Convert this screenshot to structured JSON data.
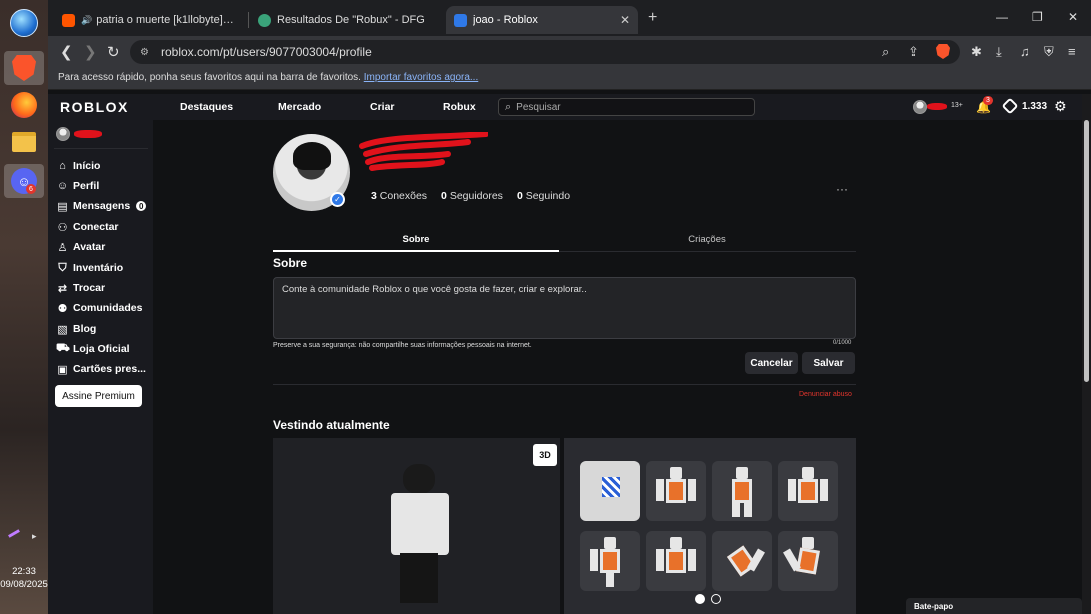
{
  "taskbar": {
    "clock_time": "22:33",
    "clock_date": "09/08/2025",
    "discord_badge": "6"
  },
  "browser": {
    "tabs": [
      {
        "title": "patria o muerte [k1llobyte] de lul"
      },
      {
        "title": "Resultados De \"Robux\" - DFG"
      },
      {
        "title": "joao - Roblox",
        "close": "✕"
      }
    ],
    "new_tab": "+",
    "url": "roblox.com/pt/users/9077003004/profile",
    "bookmarks_text": "Para acesso rápido, ponha seus favoritos aqui na barra de favoritos.",
    "bookmarks_link": "Importar favoritos agora..."
  },
  "nav": {
    "logo": "ROBLOX",
    "links": [
      "Destaques",
      "Mercado",
      "Criar",
      "Robux"
    ],
    "search_placeholder": "Pesquisar",
    "age_badge": "13+",
    "notif_count": "3",
    "robux_balance": "1.333"
  },
  "sidebar": {
    "items": [
      {
        "label": "Início",
        "icon": "home-icon"
      },
      {
        "label": "Perfil",
        "icon": "person-icon"
      },
      {
        "label": "Mensagens",
        "icon": "message-icon",
        "count": "0"
      },
      {
        "label": "Conectar",
        "icon": "friends-icon"
      },
      {
        "label": "Avatar",
        "icon": "avatar-icon"
      },
      {
        "label": "Inventário",
        "icon": "inventory-icon"
      },
      {
        "label": "Trocar",
        "icon": "trade-icon"
      },
      {
        "label": "Comunidades",
        "icon": "communities-icon"
      },
      {
        "label": "Blog",
        "icon": "blog-icon"
      },
      {
        "label": "Loja Oficial",
        "icon": "shop-icon"
      },
      {
        "label": "Cartões pres...",
        "icon": "giftcard-icon"
      }
    ],
    "premium_button": "Assine Premium"
  },
  "profile": {
    "stats": [
      {
        "count": "3",
        "label": "Conexões"
      },
      {
        "count": "0",
        "label": "Seguidores"
      },
      {
        "count": "0",
        "label": "Seguindo"
      }
    ],
    "more": "···",
    "tabs": [
      "Sobre",
      "Criações"
    ],
    "about_heading": "Sobre",
    "about_placeholder": "Conte à comunidade Roblox o que você gosta de fazer, criar e explorar..",
    "char_count": "0/1000",
    "safety_note": "Preserve a sua segurança: não compartilhe suas informações pessoais na internet.",
    "cancel_button": "Cancelar",
    "save_button": "Salvar",
    "report_link": "Denunciar abuso",
    "wearing_heading": "Vestindo atualmente",
    "view_3d": "3D"
  },
  "chat": {
    "label": "Bate-papo"
  }
}
